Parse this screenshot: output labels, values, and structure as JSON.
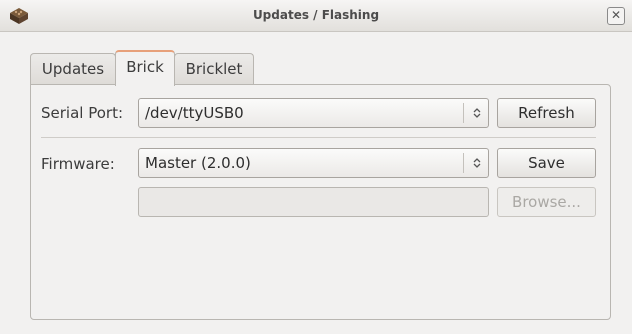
{
  "window": {
    "title": "Updates / Flashing",
    "close_glyph": "✕",
    "app_icon": "tinkerforge-brick-icon"
  },
  "tabs": [
    {
      "label": "Updates",
      "active": false
    },
    {
      "label": "Brick",
      "active": true
    },
    {
      "label": "Bricklet",
      "active": false
    }
  ],
  "brick": {
    "serial_port": {
      "label": "Serial Port:",
      "value": "/dev/ttyUSB0",
      "refresh_label": "Refresh"
    },
    "firmware": {
      "label": "Firmware:",
      "value": "Master (2.0.0)",
      "save_label": "Save"
    },
    "browse_label": "Browse...",
    "browse_enabled": false,
    "custom_path_value": ""
  },
  "combo_arrow_glyph": "⌃⌄",
  "colors": {
    "active_tab_accent": "#e7a07a",
    "background": "#f2f1f0"
  }
}
